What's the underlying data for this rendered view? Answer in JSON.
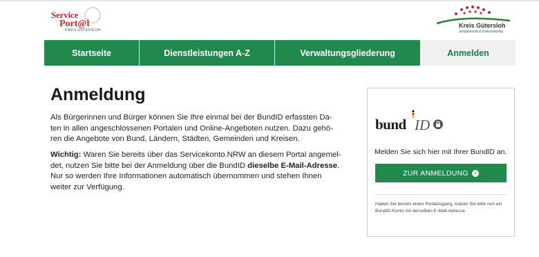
{
  "header": {
    "logo_left": {
      "line1": "Service",
      "line2": "Port@l",
      "line3": "KREIS GÜTERSLOH"
    },
    "logo_right": {
      "name": "Kreis Gütersloh",
      "tagline": "weltgewandt & bodenständig"
    }
  },
  "nav": {
    "items": [
      {
        "label": "Startseite"
      },
      {
        "label": "Dienstleistungen A-Z"
      },
      {
        "label": "Verwaltungsgliederung"
      },
      {
        "label": "Anmelden"
      }
    ],
    "active_index": 3
  },
  "main": {
    "title": "Anmeldung",
    "para1_lines": [
      "Als Bürgerinnen und Bürger können Sie Ihre einmal bei der BundID erfassten Da-",
      "ten in allen angeschlossenen Portalen und Online-Angeboten nutzen. Dazu gehö-",
      "ren die Angebote von Bund, Ländern, Städten, Gemeinden und Kreisen."
    ],
    "para2": {
      "bold_lead": "Wichtig:",
      "line1_rest": " Waren Sie bereits über das Servicekonto.NRW an diesem Portal angemel-",
      "line2_pre": "det, nutzen Sie bitte bei der Anmeldung über die BundID ",
      "line2_bold": "dieselbe E-Mail-Adresse",
      "line2_post": ".",
      "line3": "Nur so werden Ihre Informationen automatisch übernommen und stehen Ihnen",
      "line4": "weiter zur Verfügung."
    }
  },
  "card": {
    "logo_bund": "bund",
    "logo_id": "ID",
    "intro": "Melden Sie sich hier mit Ihrer BundID an.",
    "button_label": "ZUR ANMELDUNG",
    "hint": "Haben Sie bereits einen Portalzugang, nutzen Sie bitte nun ein BundID-Konto mit derselben E-Mail-Adresse."
  },
  "colors": {
    "green": "#1f8a4c",
    "red": "#c0282d"
  },
  "icons": {
    "lock": "lock-icon",
    "arrow": "arrow-right-circle-icon"
  }
}
